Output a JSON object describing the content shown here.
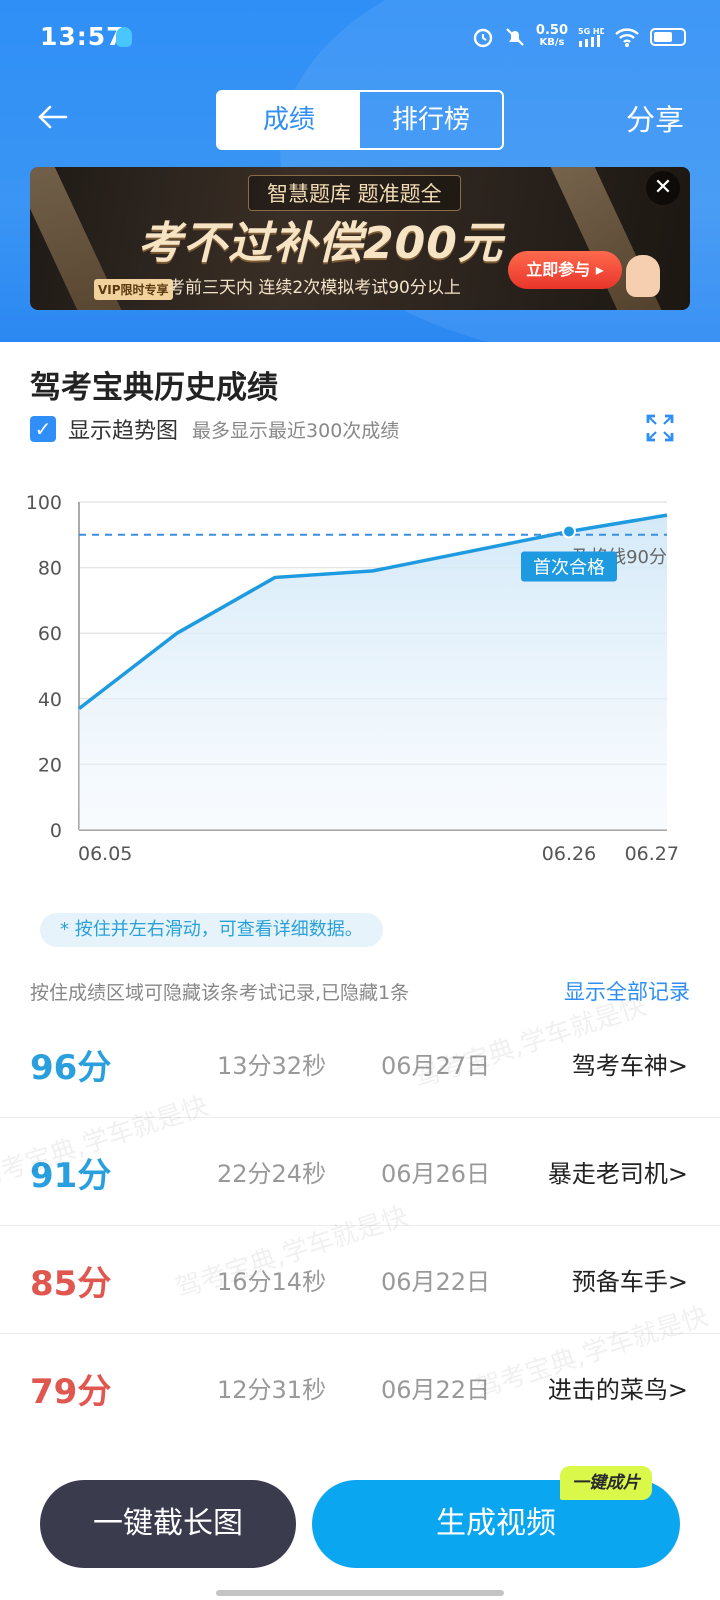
{
  "status_bar": {
    "time": "13:57",
    "net_speed": "0.50",
    "net_unit": "KB/s",
    "net_type": "5G HD",
    "icons": [
      "alarm-icon",
      "mute-icon",
      "signal-icon",
      "wifi-icon",
      "battery-icon"
    ]
  },
  "header": {
    "tabs": [
      {
        "label": "成绩",
        "active": true
      },
      {
        "label": "排行榜",
        "active": false
      }
    ],
    "share_label": "分享"
  },
  "banner": {
    "top_text": "智慧题库 题准题全",
    "main_text": "考不过补偿200元",
    "vip_tag": "VIP限时专享",
    "sub_text": "考前三天内 连续2次模拟考试90分以上",
    "cta_label": "立即参与 ▸"
  },
  "history": {
    "title": "驾考宝典历史成绩",
    "trend_label": "显示趋势图",
    "trend_hint": "最多显示最近300次成绩",
    "trend_checked": true
  },
  "chart_data": {
    "type": "area",
    "x": [
      "06.05",
      "",
      "",
      "",
      "",
      "06.26",
      "06.27"
    ],
    "values": [
      37,
      60,
      77,
      79,
      85,
      91,
      96
    ],
    "y_ticks": [
      0,
      20,
      40,
      60,
      80,
      100
    ],
    "x_tick_labels": [
      "06.05",
      "06.26",
      "06.27"
    ],
    "ylim": [
      0,
      100
    ],
    "reference_line": {
      "value": 90,
      "label": "及格线90分"
    },
    "annotation": {
      "index": 5,
      "label": "首次合格"
    },
    "grid": true,
    "line_color": "#1e9be0"
  },
  "hint": "* 按住并左右滑动，可查看详细数据。",
  "hidden_note": "按住成绩区域可隐藏该条考试记录,已隐藏1条",
  "show_all_label": "显示全部记录",
  "records": [
    {
      "score": "96分",
      "duration": "13分32秒",
      "date": "06月27日",
      "level": "驾考车神>",
      "color": "#2a9fde"
    },
    {
      "score": "91分",
      "duration": "22分24秒",
      "date": "06月26日",
      "level": "暴走老司机>",
      "color": "#2a9fde"
    },
    {
      "score": "85分",
      "duration": "16分14秒",
      "date": "06月22日",
      "level": "预备车手>",
      "color": "#e0574f"
    },
    {
      "score": "79分",
      "duration": "12分31秒",
      "date": "06月22日",
      "level": "进击的菜鸟>",
      "color": "#e0574f"
    }
  ],
  "watermark": "驾考宝典,学车就是快",
  "buttons": {
    "screenshot": "一键截长图",
    "video": "生成视频",
    "video_badge": "一键成片"
  }
}
